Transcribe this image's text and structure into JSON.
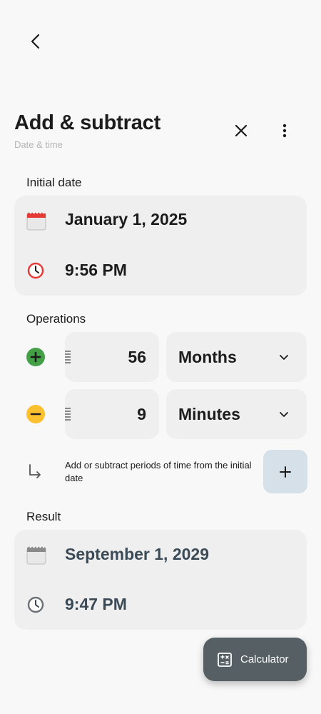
{
  "header": {
    "title": "Add & subtract",
    "subtitle": "Date & time",
    "back_icon": "arrow-left-icon",
    "close_icon": "close-icon",
    "more_icon": "more-vert-icon"
  },
  "initial": {
    "label": "Initial date",
    "date": "January 1, 2025",
    "time": "9:56 PM",
    "calendar_color": "#e53935",
    "clock_color": "#e53935"
  },
  "operations": {
    "label": "Operations",
    "items": [
      {
        "sign": "plus",
        "value": "56",
        "unit": "Months",
        "color": "#43a047"
      },
      {
        "sign": "minus",
        "value": "9",
        "unit": "Minutes",
        "color": "#fbc02d"
      }
    ],
    "hint": "Add or subtract periods of time from the initial date",
    "add_icon": "plus-icon"
  },
  "result": {
    "label": "Result",
    "date": "September 1, 2029",
    "time": "9:47 PM",
    "accent": "#3b4a57"
  },
  "fab": {
    "label": "Calculator",
    "icon": "calculator-icon"
  }
}
